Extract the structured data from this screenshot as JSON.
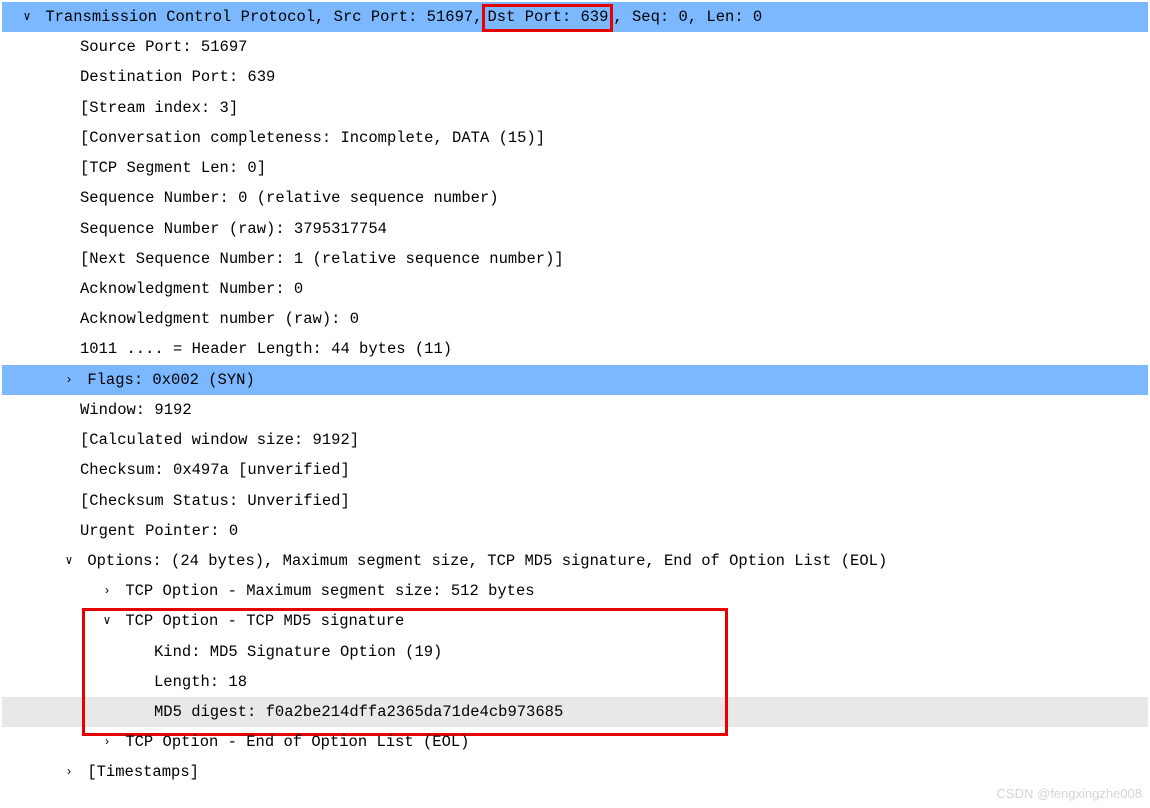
{
  "tcp": {
    "header_pre": "Transmission Control Protocol, Src Port: 51697,",
    "header_dst": " Dst Port: 639",
    "header_post": ", Seq: 0, Len: 0",
    "source_port": "Source Port: 51697",
    "dest_port": "Destination Port: 639",
    "stream_index": "[Stream index: 3]",
    "conv_complete": "[Conversation completeness: Incomplete, DATA (15)]",
    "seg_len": "[TCP Segment Len: 0]",
    "seq_rel": "Sequence Number: 0    (relative sequence number)",
    "seq_raw": "Sequence Number (raw): 3795317754",
    "next_seq": "[Next Sequence Number: 1    (relative sequence number)]",
    "ack_num": "Acknowledgment Number: 0",
    "ack_raw": "Acknowledgment number (raw): 0",
    "hdr_len": "1011 .... = Header Length: 44 bytes (11)",
    "flags": "Flags: 0x002 (SYN)",
    "window": "Window: 9192",
    "calc_win": "[Calculated window size: 9192]",
    "checksum": "Checksum: 0x497a [unverified]",
    "chk_status": "[Checksum Status: Unverified]",
    "urgent": "Urgent Pointer: 0",
    "options_hdr": "Options: (24 bytes), Maximum segment size, TCP MD5 signature, End of Option List (EOL)",
    "opt_mss": "TCP Option - Maximum segment size: 512 bytes",
    "opt_md5": "TCP Option - TCP MD5 signature",
    "md5_kind": "Kind: MD5 Signature Option (19)",
    "md5_len": "Length: 18",
    "md5_digest": "MD5 digest: f0a2be214dffa2365da71de4cb973685",
    "opt_eol": "TCP Option - End of Option List (EOL)",
    "timestamps": "[Timestamps]"
  },
  "watermark": "CSDN @fengxingzhe008"
}
